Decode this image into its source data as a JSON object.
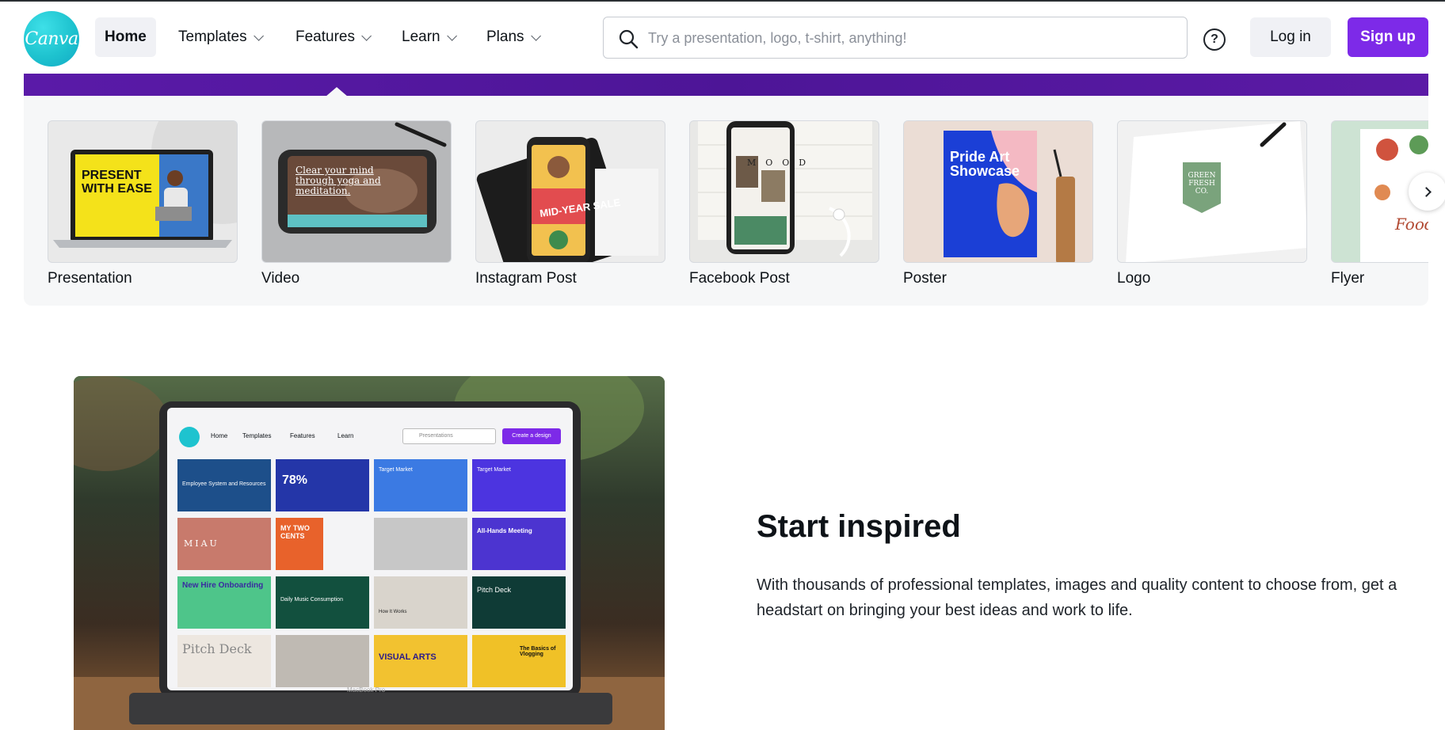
{
  "header": {
    "logo_text": "Canva",
    "nav": [
      {
        "label": "Home",
        "active": true
      },
      {
        "label": "Templates",
        "dropdown": true
      },
      {
        "label": "Features",
        "dropdown": true
      },
      {
        "label": "Learn",
        "dropdown": true
      },
      {
        "label": "Plans",
        "dropdown": true
      }
    ],
    "search_placeholder": "Try a presentation, logo, t-shirt, anything!",
    "help_icon": "question-circle-icon",
    "login_label": "Log in",
    "signup_label": "Sign up"
  },
  "colors": {
    "brand_purple": "#7d2ae8",
    "banner_purple": "#4d1597",
    "logo_teal": "#1ec3cf"
  },
  "carousel": {
    "items": [
      {
        "label": "Presentation"
      },
      {
        "label": "Video"
      },
      {
        "label": "Instagram Post"
      },
      {
        "label": "Facebook Post"
      },
      {
        "label": "Poster"
      },
      {
        "label": "Logo"
      },
      {
        "label": "Flyer"
      }
    ],
    "next_icon": "chevron-right-icon"
  },
  "section": {
    "title": "Start inspired",
    "body": "With thousands of professional templates, images and quality content to choose from, get a headstart on bringing your best ideas and work to life."
  },
  "thumb_text": {
    "presentation": "PRESENT\nWITH EASE",
    "video": "Clear your mind through yoga and meditation.",
    "instagram": "MID-YEAR SALE",
    "facebook": "MOOD",
    "poster": "Pride Art Showcase",
    "logo": "GREEN FRESH CO.",
    "flyer": "Food"
  },
  "laptop": {
    "nav": [
      "Home",
      "Templates",
      "Features",
      "Learn"
    ],
    "search_placeholder": "Presentations",
    "cta": "Create a design",
    "brand": "MacBook Pro",
    "tiles": [
      "Employee System and Resources",
      "78%",
      "Target Market",
      "Target Market",
      "MIAU",
      "MY TWO CENTS",
      "",
      "All-Hands Meeting",
      "New Hire Onboarding",
      "Daily Music Consumption",
      "How It Works",
      "Pitch Deck",
      "Pitch Deck",
      "",
      "VISUAL ARTS",
      "The Basics of Vlogging"
    ]
  }
}
